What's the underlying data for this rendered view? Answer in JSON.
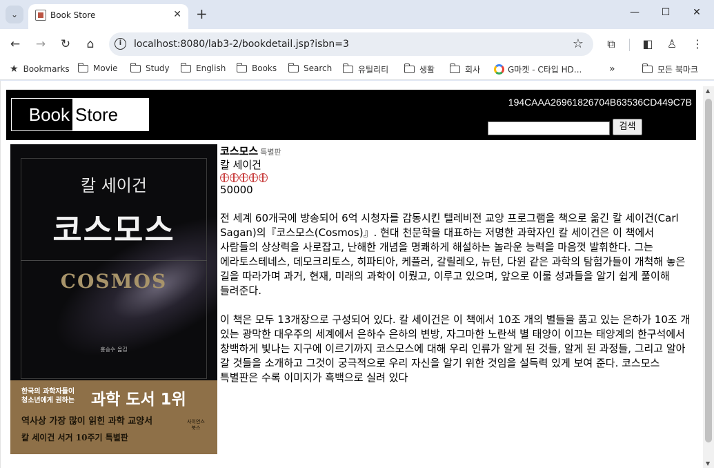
{
  "browser": {
    "tab_title": "Book Store",
    "url": "localhost:8080/lab3-2/bookdetail.jsp?isbn=3",
    "bookmarks": [
      {
        "label": "Bookmarks",
        "icon": "star-icon"
      },
      {
        "label": "Movie",
        "icon": "folder-icon"
      },
      {
        "label": "Study",
        "icon": "folder-icon"
      },
      {
        "label": "English",
        "icon": "folder-icon"
      },
      {
        "label": "Books",
        "icon": "folder-icon"
      },
      {
        "label": "Search",
        "icon": "folder-icon"
      },
      {
        "label": "유틸리티",
        "icon": "folder-icon"
      },
      {
        "label": "생활",
        "icon": "folder-icon"
      },
      {
        "label": "회사",
        "icon": "folder-icon"
      },
      {
        "label": "G마켓 - C타입 HD...",
        "icon": "google-icon"
      }
    ],
    "all_bookmarks": "모든 북마크"
  },
  "header": {
    "logo_left": "Book",
    "logo_right": "Store",
    "session_id": "194CAAA26961826704B63536CD449C7B",
    "search_button": "검색",
    "search_value": ""
  },
  "cover": {
    "author": "칼 세이건",
    "title": "코스모스",
    "title_en": "COSMOS",
    "translator": "홍승수 옮김",
    "band_small_1": "한국의 과학자들이",
    "band_small_2": "청소년에게 권하는",
    "band_big": "과학 도서 1위",
    "band_line2": "역사상 가장 많이 읽힌 과학 교양서",
    "band_line3": "칼 세이건 서거 10주기 특별판",
    "publisher": "사이언스북스"
  },
  "book": {
    "title": "코스모스",
    "edition": "특별판",
    "author": "칼 세이건",
    "rating": 5,
    "price": "50000",
    "description_1": "전 세계 60개국에 방송되어 6억 시청자를 감동시킨 텔레비전 교양 프로그램을 책으로 옮긴 칼 세이건(Carl Sagan)의『코스모스(Cosmos)』. 현대 천문학을 대표하는 저명한 과학자인 칼 세이건은 이 책에서 사람들의 상상력을 사로잡고, 난해한 개념을 명쾌하게 해설하는 놀라운 능력을 마음껏 발휘한다. 그는 에라토스테네스, 데모크리토스, 히파티아, 케플러, 갈릴레오, 뉴턴, 다윈 같은 과학의 탐험가들이 개척해 놓은 길을 따라가며 과거, 현재, 미래의 과학이 이뤘고, 이루고 있으며, 앞으로 이룰 성과들을 알기 쉽게 풀이해 들려준다.",
    "description_2": "이 책은 모두 13개장으로 구성되어 있다. 칼 세이건은 이 책에서 10조 개의 별들을 품고 있는 은하가 10조 개 있는 광막한 대우주의 세계에서 은하수 은하의 변방, 자그마한 노란색 별 태양이 이끄는 태양계의 한구석에서 창백하게 빛나는 지구에 이르기까지 코스모스에 대해 우리 인류가 알게 된 것들, 알게 된 과정들, 그리고 알아 갈 것들을 소개하고 그것이 궁극적으로 우리 자신을 알기 위한 것임을 설득력 있게 보여 준다. 코스모스 특별판은 수록 이미지가 흑백으로 실려 있다"
  }
}
